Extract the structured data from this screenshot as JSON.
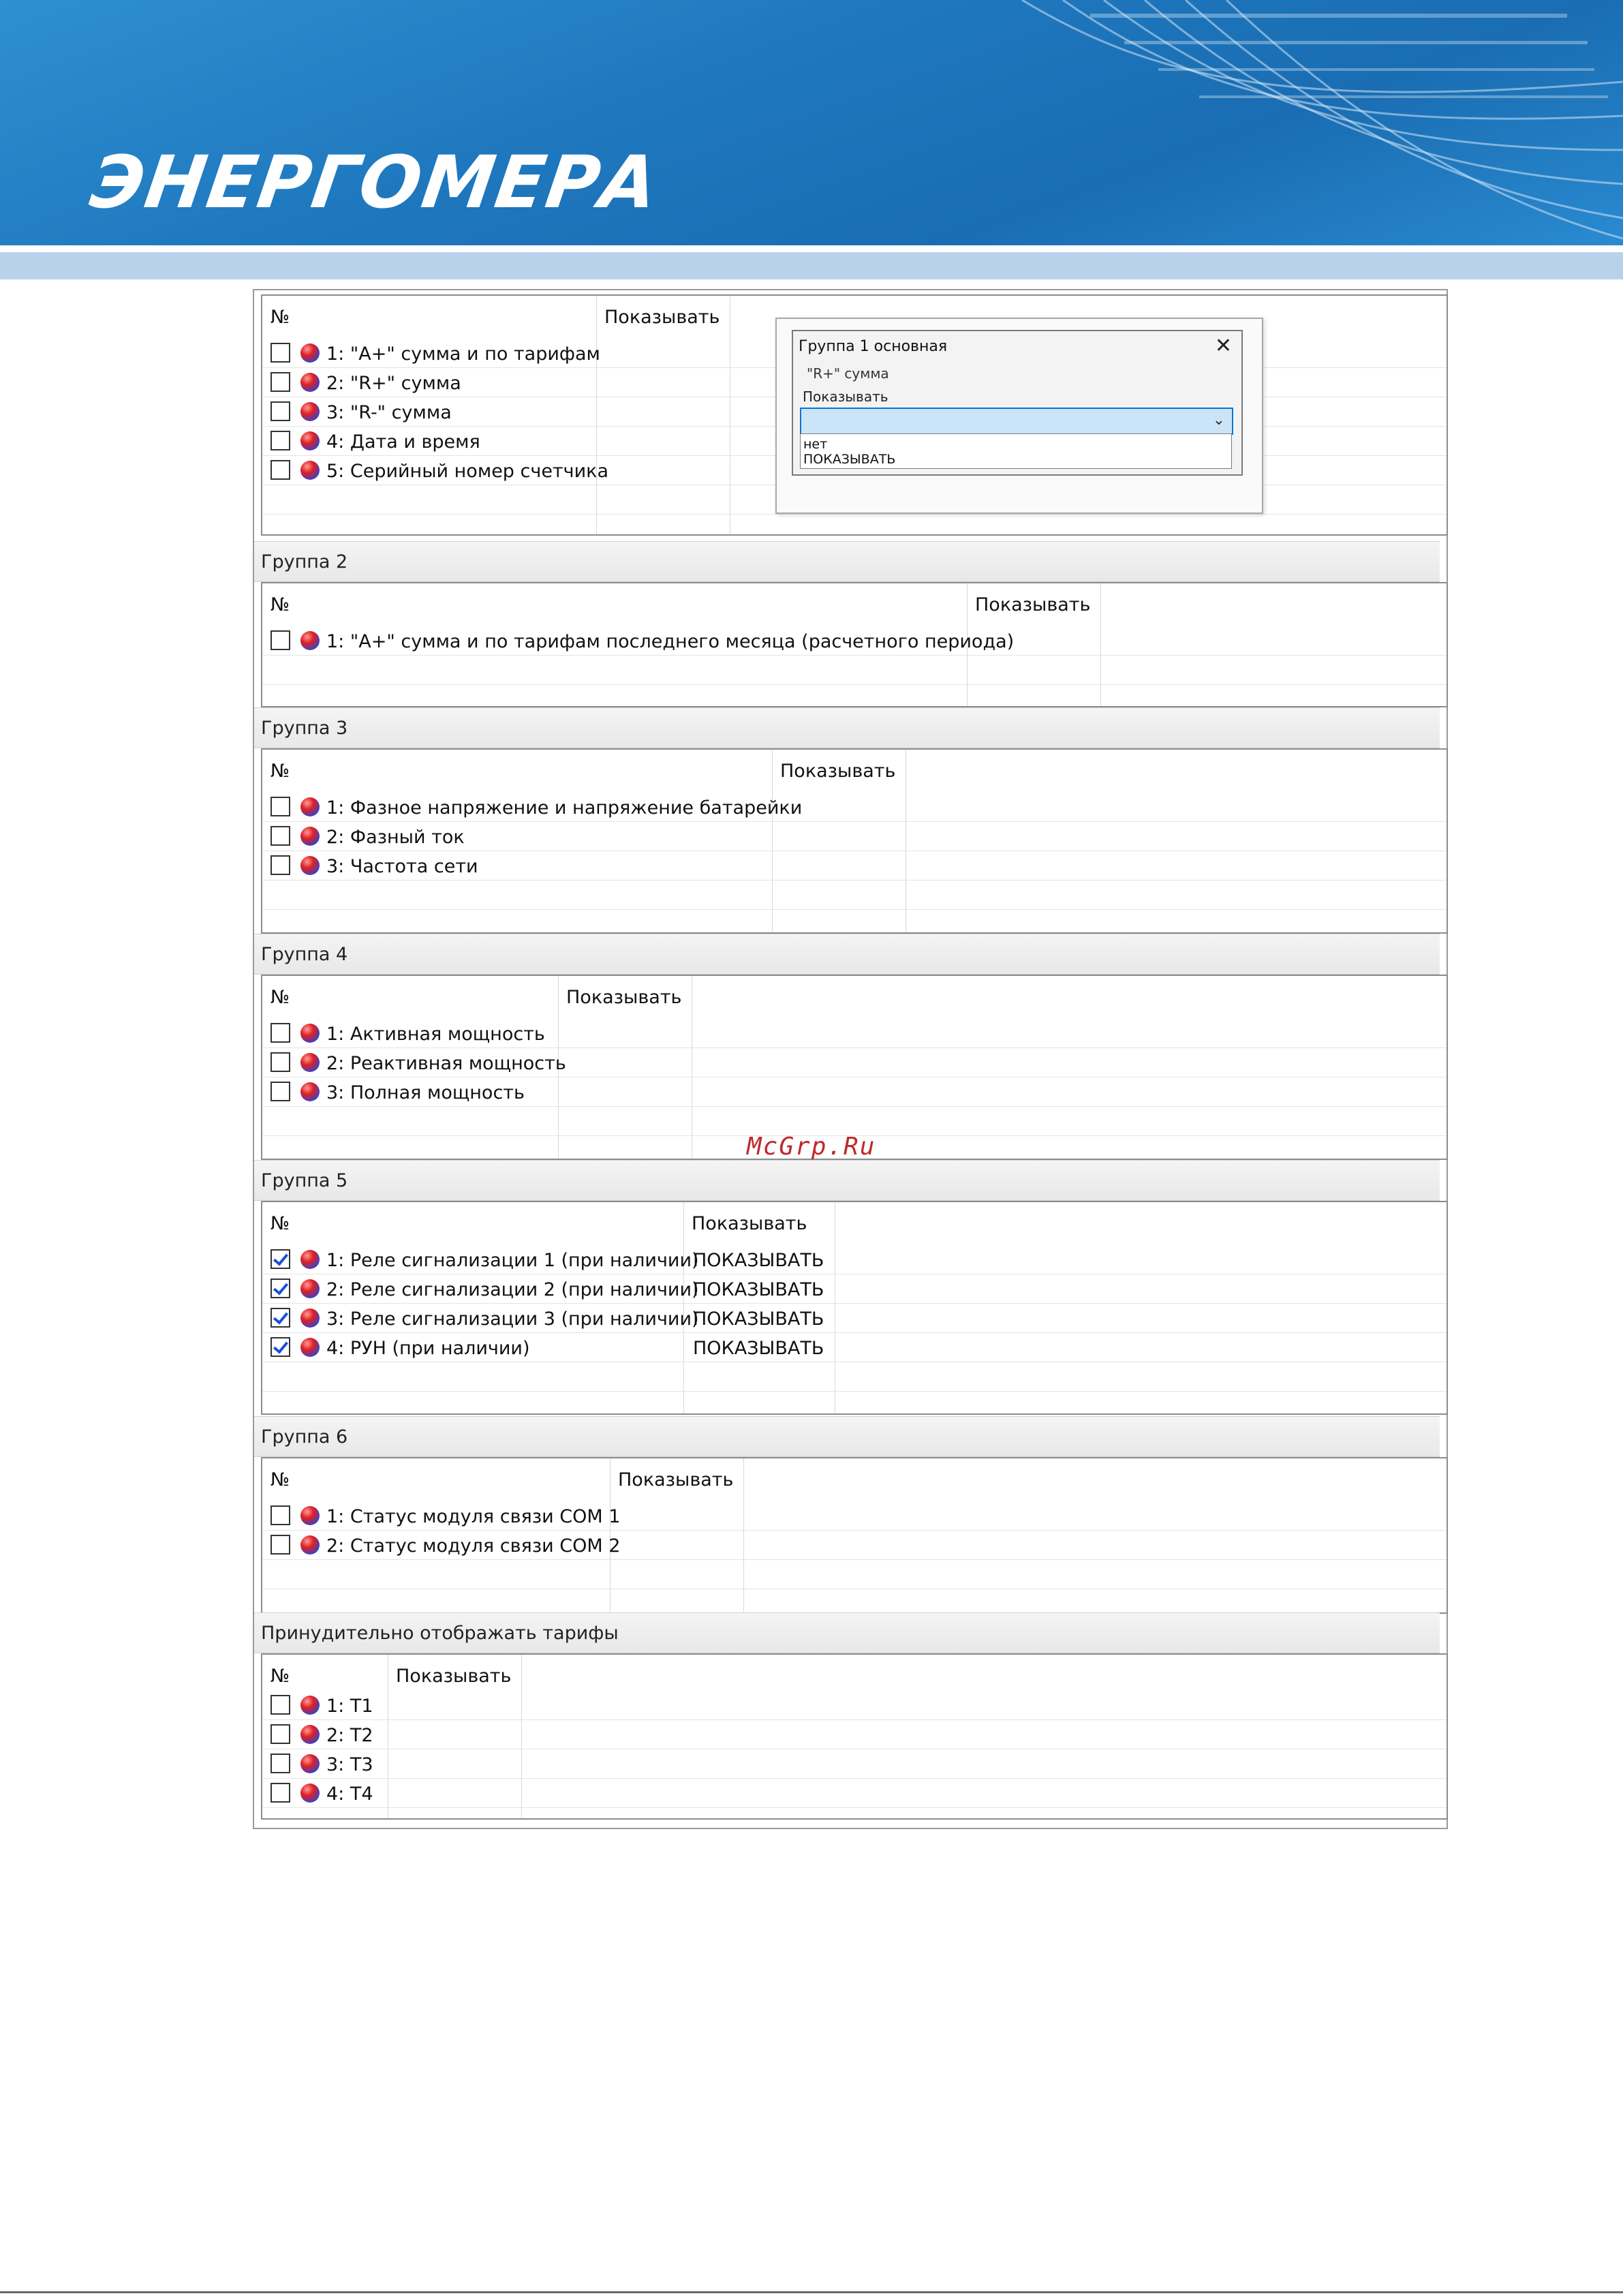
{
  "header": {
    "logo": "ЭНЕРГОМЕРА"
  },
  "col_no": "№",
  "col_show": "Показывать",
  "group1": {
    "rows": [
      {
        "label": "1: \"A+\" сумма и по тарифам",
        "checked": false,
        "value": ""
      },
      {
        "label": "2: \"R+\" сумма",
        "checked": false,
        "value": ""
      },
      {
        "label": "3: \"R-\" сумма",
        "checked": false,
        "value": ""
      },
      {
        "label": "4: Дата и время",
        "checked": false,
        "value": ""
      },
      {
        "label": "5: Серийный номер счетчика",
        "checked": false,
        "value": ""
      }
    ]
  },
  "dialog": {
    "title": "Группа 1 основная",
    "item": "\"R+\" сумма",
    "field_label": "Показывать",
    "combo_value": "",
    "options": [
      "нет",
      "ПОКАЗЫВАТЬ"
    ]
  },
  "group2": {
    "title": "Группа 2",
    "rows": [
      {
        "label": "1: \"A+\" сумма и по тарифам последнего месяца (расчетного периода)",
        "checked": false,
        "value": ""
      }
    ]
  },
  "group3": {
    "title": "Группа 3",
    "rows": [
      {
        "label": "1: Фазное напряжение и напряжение батарейки",
        "checked": false,
        "value": ""
      },
      {
        "label": "2: Фазный ток",
        "checked": false,
        "value": ""
      },
      {
        "label": "3: Частота сети",
        "checked": false,
        "value": ""
      }
    ]
  },
  "group4": {
    "title": "Группа 4",
    "rows": [
      {
        "label": "1: Активная мощность",
        "checked": false,
        "value": ""
      },
      {
        "label": "2: Реактивная мощность",
        "checked": false,
        "value": ""
      },
      {
        "label": "3: Полная мощность",
        "checked": false,
        "value": ""
      }
    ]
  },
  "group5": {
    "title": "Группа 5",
    "rows": [
      {
        "label": "1: Реле сигнализации 1 (при наличии)",
        "checked": true,
        "value": "ПОКАЗЫВАТЬ"
      },
      {
        "label": "2: Реле сигнализации 2 (при наличии)",
        "checked": true,
        "value": "ПОКАЗЫВАТЬ"
      },
      {
        "label": "3: Реле сигнализации 3 (при наличии)",
        "checked": true,
        "value": "ПОКАЗЫВАТЬ"
      },
      {
        "label": "4: РУН (при наличии)",
        "checked": true,
        "value": "ПОКАЗЫВАТЬ"
      }
    ]
  },
  "group6": {
    "title": "Группа 6",
    "rows": [
      {
        "label": "1: Статус модуля связи COM 1",
        "checked": false,
        "value": ""
      },
      {
        "label": "2: Статус модуля связи COM 2",
        "checked": false,
        "value": ""
      }
    ]
  },
  "tariffs": {
    "title": "Принудительно отображать тарифы",
    "rows": [
      {
        "label": "1: T1",
        "checked": false,
        "value": ""
      },
      {
        "label": "2: T2",
        "checked": false,
        "value": ""
      },
      {
        "label": "3: T3",
        "checked": false,
        "value": ""
      },
      {
        "label": "4: T4",
        "checked": false,
        "value": ""
      }
    ]
  },
  "watermark": "McGrp.Ru",
  "colors": {
    "banner": "#1f78be",
    "band": "#b9d2ea",
    "check": "#1b4fd6",
    "watermark": "#c0282d"
  }
}
